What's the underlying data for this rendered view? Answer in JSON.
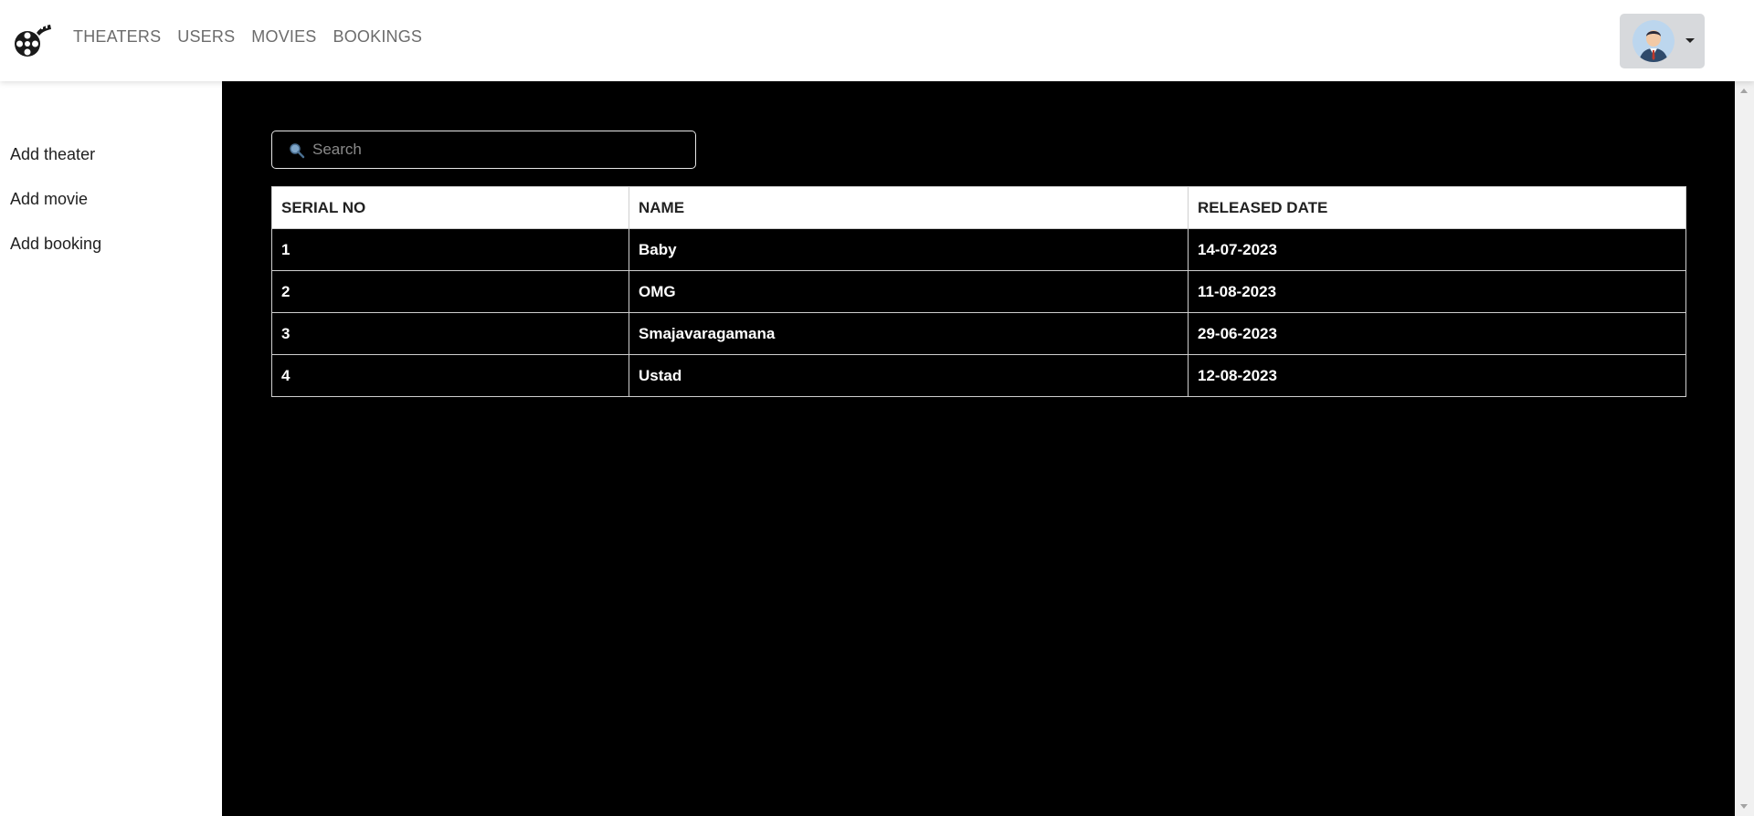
{
  "nav": {
    "links": [
      "THEATERS",
      "USERS",
      "MOVIES",
      "BOOKINGS"
    ]
  },
  "sidebar": {
    "items": [
      "Add theater",
      "Add movie",
      "Add booking"
    ]
  },
  "search": {
    "placeholder": "Search"
  },
  "table": {
    "headers": [
      "SERIAL NO",
      "NAME",
      "RELEASED DATE"
    ],
    "rows": [
      [
        "1",
        "Baby",
        "14-07-2023"
      ],
      [
        "2",
        "OMG",
        "11-08-2023"
      ],
      [
        "3",
        "Smajavaragamana",
        "29-06-2023"
      ],
      [
        "4",
        "Ustad",
        "12-08-2023"
      ]
    ]
  },
  "colors": {
    "main_bg": "#000000",
    "nav_text": "#6c6c6c",
    "user_button_bg": "#d7d9dc"
  },
  "icons": {
    "logo": "film-reel-icon",
    "search": "magnifier-icon",
    "avatar": "user-avatar-icon",
    "dropdown": "caret-down-icon"
  }
}
